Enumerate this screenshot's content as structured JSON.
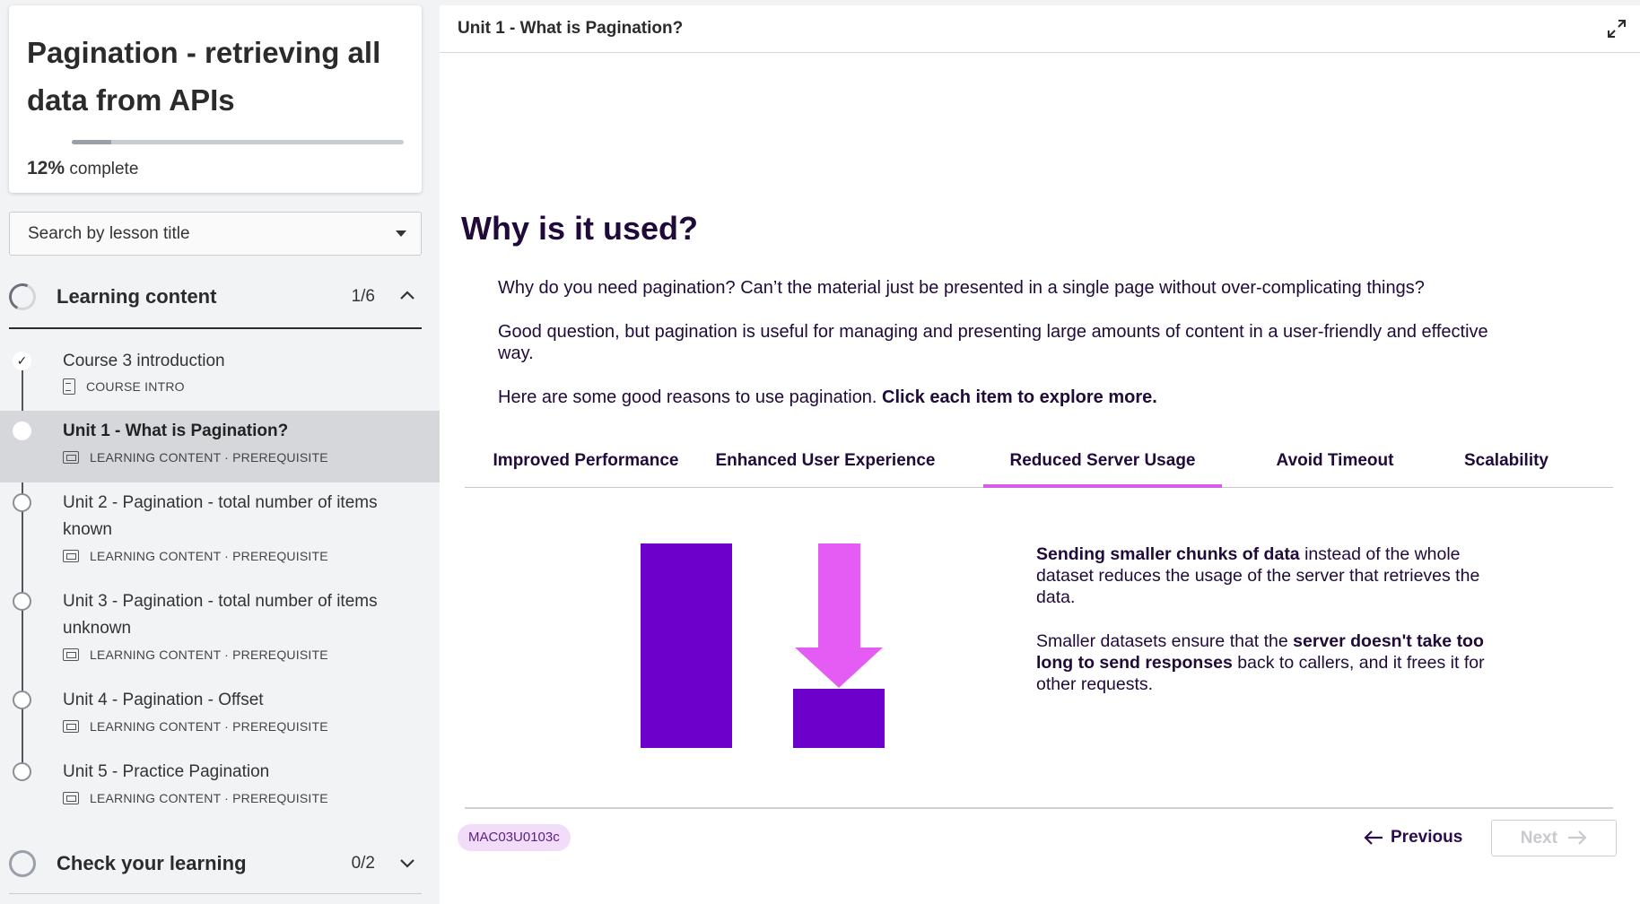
{
  "course": {
    "title": "Pagination - retrieving all data from APIs",
    "progress_percent": "12%",
    "progress_fraction": 0.12,
    "progress_suffix": "complete"
  },
  "search": {
    "placeholder": "Search by lesson title"
  },
  "sections": [
    {
      "label": "Learning content",
      "count": "1/6"
    },
    {
      "label": "Check your learning",
      "count": "0/2"
    }
  ],
  "lessons": [
    {
      "title": "Course 3 introduction",
      "meta": "COURSE INTRO"
    },
    {
      "title": "Unit 1 - What is Pagination?",
      "meta": "LEARNING CONTENT · PREREQUISITE"
    },
    {
      "title": "Unit 2 - Pagination - total number of items known",
      "meta": "LEARNING CONTENT · PREREQUISITE"
    },
    {
      "title": "Unit 3 - Pagination - total number of items unknown",
      "meta": "LEARNING CONTENT · PREREQUISITE"
    },
    {
      "title": "Unit 4 - Pagination - Offset",
      "meta": "LEARNING CONTENT · PREREQUISITE"
    },
    {
      "title": "Unit 5 - Practice Pagination",
      "meta": "LEARNING CONTENT · PREREQUISITE"
    }
  ],
  "main": {
    "header_title": "Unit 1 - What is Pagination?",
    "heading": "Why is it used?",
    "p1": "Why do you need pagination? Can’t the material just be presented in a single page without over-complicating things?",
    "p2": "Good question, but pagination is useful for managing and presenting large amounts of content in a user-friendly and effective way.",
    "p3_plain": "Here are some good reasons to use pagination. ",
    "p3_bold": "Click each item to explore more.",
    "tabs": [
      "Improved Performance",
      "Enhanced User Experience",
      "Reduced Server Usage",
      "Avoid Timeout",
      "Scalability"
    ],
    "selected_tab": "Reduced Server Usage",
    "desc1_bold": "Sending smaller chunks of data",
    "desc1_rest": " instead of the whole dataset reduces the usage of the server that retrieves the data.",
    "desc2_a": "Smaller datasets ensure that the ",
    "desc2_bold": "server doesn't take too long to send responses",
    "desc2_c": " back to callers, and it frees it for other requests.",
    "code": "MAC03U0103c",
    "prev_label": "Previous",
    "next_label": "Next"
  },
  "colors": {
    "purple": "#6e00cc",
    "pink": "#e55cf5",
    "tab_underline": "#d45de8",
    "heading": "#1f0a3a"
  }
}
